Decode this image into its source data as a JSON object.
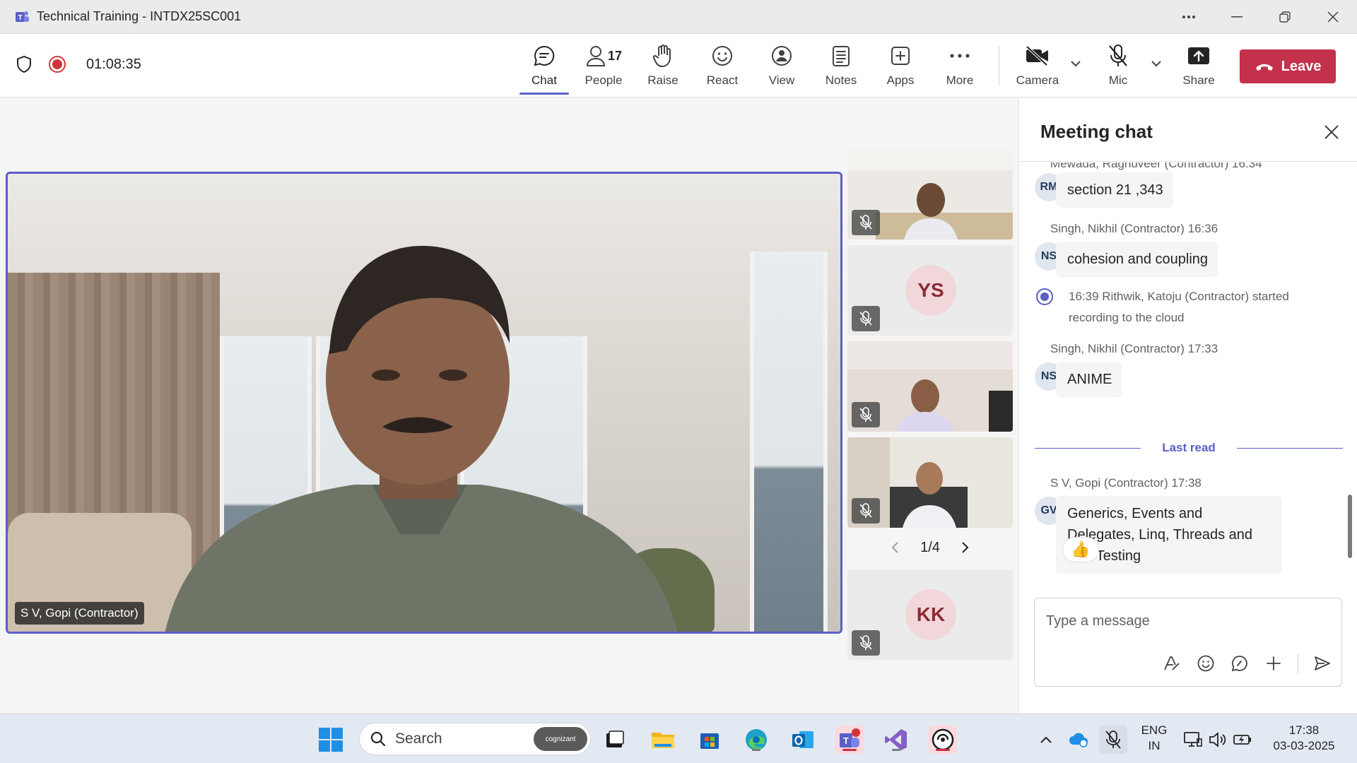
{
  "window": {
    "title": "Technical Training - INTDX25SC001"
  },
  "toolbar": {
    "timer": "01:08:35",
    "chat_label": "Chat",
    "people_label": "People",
    "people_count": "17",
    "raise_label": "Raise",
    "react_label": "React",
    "view_label": "View",
    "notes_label": "Notes",
    "apps_label": "Apps",
    "more_label": "More",
    "camera_label": "Camera",
    "mic_label": "Mic",
    "share_label": "Share",
    "leave_label": "Leave"
  },
  "stage": {
    "main_name": "S V, Gopi (Contractor)",
    "tiles": [
      {
        "type": "video",
        "muted": true
      },
      {
        "type": "avatar",
        "initials": "YS",
        "muted": true
      },
      {
        "type": "video",
        "muted": true
      },
      {
        "type": "video",
        "muted": true
      }
    ],
    "pager": "1/4",
    "extra_tile_initials": "KK"
  },
  "chat": {
    "title": "Meeting chat",
    "partial_meta": "Mewada, Raghuveer (Contractor) 16:34",
    "messages": [
      {
        "initials": "RM",
        "text": "section 21 ,343"
      },
      {
        "meta": "Singh, Nikhil (Contractor)  16:36",
        "initials": "NS",
        "text": "cohesion and coupling"
      },
      {
        "meta": "Singh, Nikhil (Contractor)  17:33",
        "initials": "NS",
        "text": "ANIME"
      },
      {
        "meta": "S V, Gopi (Contractor)  17:38",
        "initials": "GV",
        "text_lines": [
          "Generics, Events and",
          "Delegates, Linq, Threads and",
          "Unit Testing"
        ]
      }
    ],
    "system_event": {
      "line1": "16:39   Rithwik, Katoju (Contractor) started",
      "line2": "recording to the cloud"
    },
    "last_read_label": "Last read",
    "reaction": "👍",
    "composer_placeholder": "Type a message"
  },
  "taskbar": {
    "search_label": "Search",
    "search_badge": "cognizant",
    "lang_line1": "ENG",
    "lang_line2": "IN",
    "time": "17:38",
    "date": "03-03-2025"
  },
  "colors": {
    "accent": "#5b5fc7",
    "leave": "#c4314b",
    "record": "#d13438"
  }
}
